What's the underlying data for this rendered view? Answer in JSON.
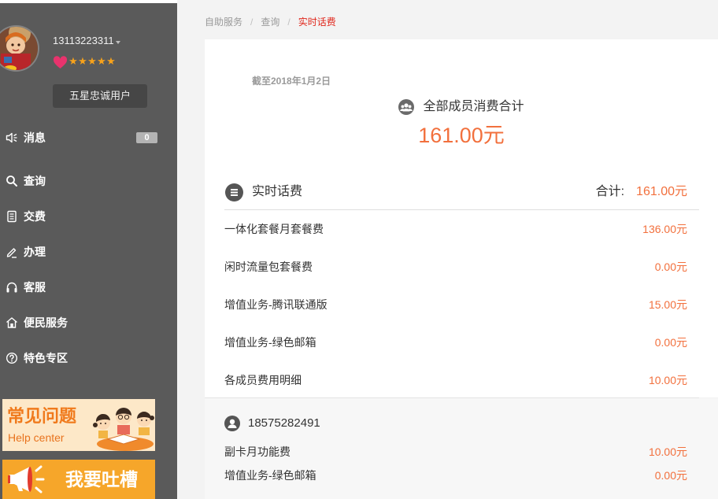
{
  "colors": {
    "sidebar_bg": "#5a5a5a",
    "accent_orange": "#f2703d",
    "breadcrumb_active": "#e0261b",
    "star": "#f7a21b",
    "heart": "#e8336d"
  },
  "sidebar": {
    "user": {
      "avatar_icon": "cartoon-avatar",
      "phone": "13113223311",
      "stars": 5,
      "level_label": "五星忠诚用户"
    },
    "menu": [
      {
        "label": "消息",
        "icon": "speaker-icon",
        "badge": "0"
      },
      {
        "label": "查询",
        "icon": "search-icon"
      },
      {
        "label": "交费",
        "icon": "bill-icon"
      },
      {
        "label": "办理",
        "icon": "pencil-icon"
      },
      {
        "label": "客服",
        "icon": "headset-icon"
      },
      {
        "label": "便民服务",
        "icon": "house-icon"
      },
      {
        "label": "特色专区",
        "icon": "question-circle-icon"
      }
    ],
    "banners": {
      "help_center": {
        "title": "常见问题",
        "subtitle": "Help center",
        "icon": "kids-illustration"
      },
      "complaint": {
        "title": "我要吐槽",
        "icon": "megaphone-icon"
      }
    }
  },
  "breadcrumb": {
    "separator": "/",
    "items": [
      "自助服务",
      "查询",
      "实时话费"
    ]
  },
  "summary": {
    "as_of": "截至2018年1月2日",
    "total_label": "全部成员消费合计",
    "total_amount": "161.00元"
  },
  "realtime_fees": {
    "title": "实时话费",
    "total_label": "合计:",
    "total_amount": "161.00元",
    "items": [
      {
        "label": "一体化套餐月套餐费",
        "amount": "136.00元"
      },
      {
        "label": "闲时流量包套餐费",
        "amount": "0.00元"
      },
      {
        "label": "增值业务-腾讯联通版",
        "amount": "15.00元"
      },
      {
        "label": "增值业务-绿色邮箱",
        "amount": "0.00元"
      },
      {
        "label": "各成员费用明细",
        "amount": "10.00元"
      }
    ]
  },
  "member_detail": {
    "phone": "18575282491",
    "items": [
      {
        "label": "副卡月功能费",
        "amount": "10.00元"
      },
      {
        "label": "增值业务-绿色邮箱",
        "amount": "0.00元"
      }
    ]
  }
}
